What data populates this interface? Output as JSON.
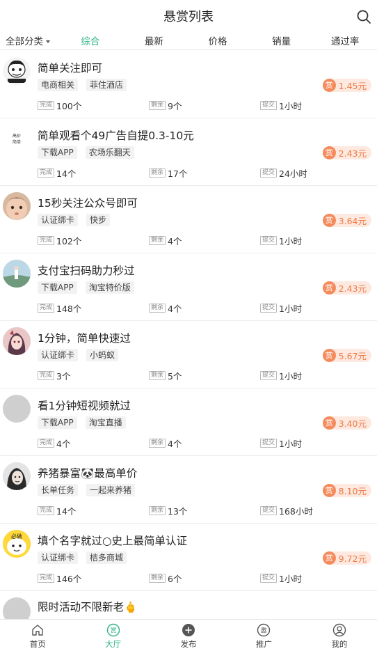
{
  "header": {
    "title": "悬赏列表"
  },
  "tabs": [
    {
      "label": "全部分类"
    },
    {
      "label": "综合"
    },
    {
      "label": "最新"
    },
    {
      "label": "价格"
    },
    {
      "label": "销量"
    },
    {
      "label": "通过率"
    }
  ],
  "meta_labels": {
    "done": "完成",
    "left": "剩余",
    "submit": "提交"
  },
  "reward_label": "赏",
  "items": [
    {
      "title": "简单关注即可",
      "tags": [
        "电商相关",
        "菲住酒店"
      ],
      "done": "100个",
      "left": "9个",
      "submit": "1小时",
      "reward": "1.45元"
    },
    {
      "title": "简单观看个49广告自提0.3-10元",
      "tags": [
        "下载APP",
        "农场乐翻天"
      ],
      "done": "14个",
      "left": "17个",
      "submit": "24小时",
      "reward": "2.43元"
    },
    {
      "title": "15秒关注公众号即可",
      "tags": [
        "认证绑卡",
        "快步"
      ],
      "done": "102个",
      "left": "4个",
      "submit": "1小时",
      "reward": "3.64元"
    },
    {
      "title": "支付宝扫码助力秒过",
      "tags": [
        "下载APP",
        "淘宝特价版"
      ],
      "done": "148个",
      "left": "4个",
      "submit": "1小时",
      "reward": "2.43元"
    },
    {
      "title": "1分钟，简单快速过",
      "tags": [
        "认证绑卡",
        "小蚂蚁"
      ],
      "done": "3个",
      "left": "5个",
      "submit": "1小时",
      "reward": "5.67元"
    },
    {
      "title": "看1分钟短视频就过",
      "tags": [
        "下载APP",
        "淘宝直播"
      ],
      "done": "4个",
      "left": "4个",
      "submit": "1小时",
      "reward": "3.40元"
    },
    {
      "title": "养猪暴富🐼最高单价",
      "tags": [
        "长单任务",
        "一起来养猪"
      ],
      "done": "14个",
      "left": "13个",
      "submit": "168小时",
      "reward": "8.10元"
    },
    {
      "title": "填个名字就过○史上最简单认证",
      "tags": [
        "认证绑卡",
        "桔多商城"
      ],
      "done": "146个",
      "left": "6个",
      "submit": "1小时",
      "reward": "9.72元"
    },
    {
      "title": "限时活动不限新老🖕"
    }
  ],
  "avatars": {
    "a2_text_line1": "高价",
    "a2_text_line2": "简单",
    "a8_text": "必做"
  },
  "bottom_nav": [
    {
      "label": "首页"
    },
    {
      "label": "大厅",
      "icon_text": "赏"
    },
    {
      "label": "发布"
    },
    {
      "label": "推广",
      "icon_text": "邀"
    },
    {
      "label": "我的"
    }
  ],
  "colors": {
    "accent": "#2fb383",
    "reward": "#f07a45",
    "reward_bg": "#fde9e0"
  }
}
